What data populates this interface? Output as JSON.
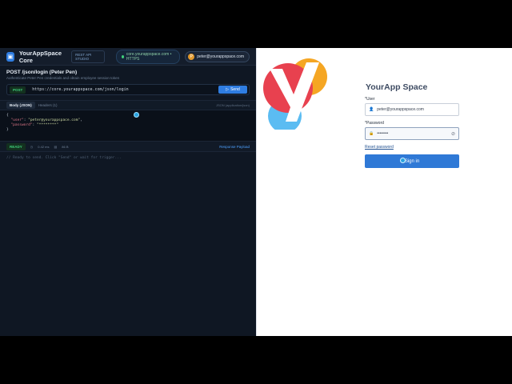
{
  "left_panel": {
    "app_title": "YourAppSpace Core",
    "badge": "REST API STUDIO",
    "host": "core.yourappspace.com • HTTPS",
    "user": "peter@yourappspace.com",
    "user_initial": "P",
    "request_title": "POST /json/login (Peter Pen)",
    "request_subtitle": "Authenticate Peter Pen credentials and obtain employee session token",
    "method": "POST",
    "url": "https://core.yourappspace.com/json/login",
    "send_label": "Send",
    "tabs": [
      {
        "label": "Body (JSON)",
        "active": true
      },
      {
        "label": "Headers (1)",
        "active": false
      }
    ],
    "content_type": "JSON (application/json)",
    "body": {
      "open": "{",
      "user_key": "\"user\"",
      "user_val": "\"peter@yourappspace.com\"",
      "password_key": "\"password\"",
      "password_val": "\"********\"",
      "close": "}"
    },
    "status": "READY",
    "time": "0.42 ms",
    "size": "86 B",
    "response_label": "Response Payload",
    "response_text": "// Ready to send. Click \"Send\" or wait for trigger..."
  },
  "right_panel": {
    "title": "YourApp Space",
    "user_label": "*User",
    "user_value": "peter@yourappspace.com",
    "password_label": "*Password",
    "password_value": "••••••••",
    "reset_link": "Reset password",
    "signin_label": "Sign in",
    "brand_letter": "y"
  },
  "colors": {
    "accent": "#2f79d6",
    "ready_green": "#3fcf7a",
    "logo_red": "#e8414f",
    "logo_orange": "#f5a623",
    "logo_blue": "#5bbcf2"
  }
}
